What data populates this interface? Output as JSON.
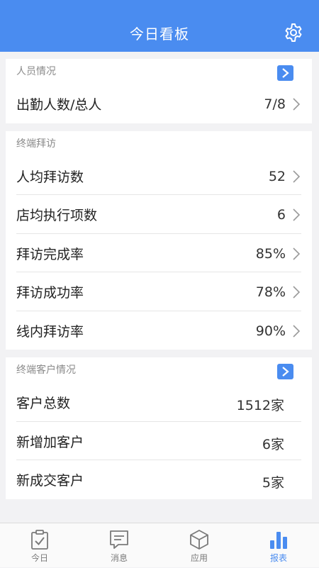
{
  "header": {
    "title": "今日看板",
    "settings_icon": "gear-icon"
  },
  "staff": {
    "title": "人员情况",
    "row": {
      "label": "出勤人数/总人",
      "value": "7/8"
    }
  },
  "visits": {
    "title": "终端拜访",
    "rows": [
      {
        "label": "人均拜访数",
        "value": "52"
      },
      {
        "label": "店均执行项数",
        "value": "6"
      },
      {
        "label": "拜访完成率",
        "value": "85%"
      },
      {
        "label": "拜访成功率",
        "value": "78%"
      },
      {
        "label": "线内拜访率",
        "value": "90%"
      }
    ]
  },
  "customers": {
    "title": "终端客户情况",
    "rows": [
      {
        "label": "客户总数",
        "value": "1512家"
      },
      {
        "label": "新增加客户",
        "value": "6家"
      },
      {
        "label": "新成交客户",
        "value": "5家"
      }
    ]
  },
  "tabbar": {
    "tabs": [
      {
        "label": "今日",
        "icon": "clipboard-check-icon"
      },
      {
        "label": "消息",
        "icon": "message-icon"
      },
      {
        "label": "应用",
        "icon": "cube-icon"
      },
      {
        "label": "报表",
        "icon": "bar-chart-icon"
      }
    ],
    "active_index": 3
  },
  "colors": {
    "accent": "#4a8cf0",
    "background": "#f2f2f4"
  }
}
